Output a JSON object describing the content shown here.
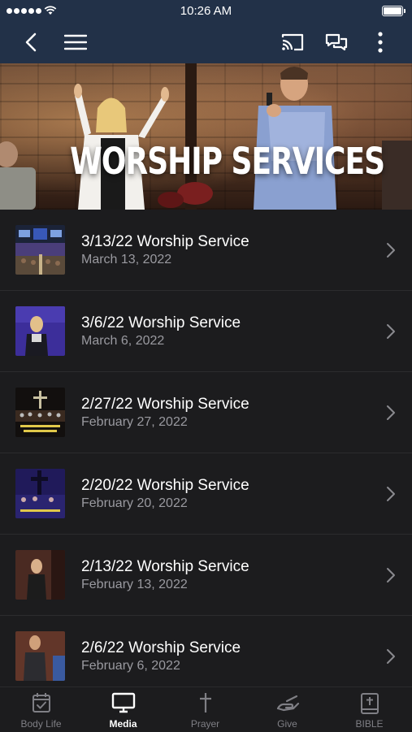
{
  "status_bar": {
    "time": "10:26 AM"
  },
  "nav": {
    "back_icon": "chevron-left-icon",
    "menu_icon": "hamburger-icon",
    "cast_icon": "cast-icon",
    "chat_icon": "chat-icon",
    "more_icon": "more-vertical-icon"
  },
  "hero": {
    "title": "WORSHIP SERVICES"
  },
  "services": [
    {
      "title": "3/13/22 Worship Service",
      "date": "March 13, 2022"
    },
    {
      "title": "3/6/22 Worship Service",
      "date": "March 6, 2022"
    },
    {
      "title": "2/27/22 Worship Service",
      "date": "February 27, 2022"
    },
    {
      "title": "2/20/22 Worship Service",
      "date": "February 20, 2022"
    },
    {
      "title": "2/13/22 Worship Service",
      "date": "February 13, 2022"
    },
    {
      "title": "2/6/22 Worship Service",
      "date": "February 6, 2022"
    }
  ],
  "tabs": [
    {
      "label": "Body Life",
      "icon": "calendar-check-icon"
    },
    {
      "label": "Media",
      "icon": "tv-icon",
      "active": true
    },
    {
      "label": "Prayer",
      "icon": "cross-icon"
    },
    {
      "label": "Give",
      "icon": "give-hand-icon"
    },
    {
      "label": "BIBLE",
      "icon": "bible-icon"
    }
  ],
  "colors": {
    "nav_bg": "#223148",
    "list_bg": "#1c1c1e",
    "secondary_text": "#9a9aa0"
  }
}
